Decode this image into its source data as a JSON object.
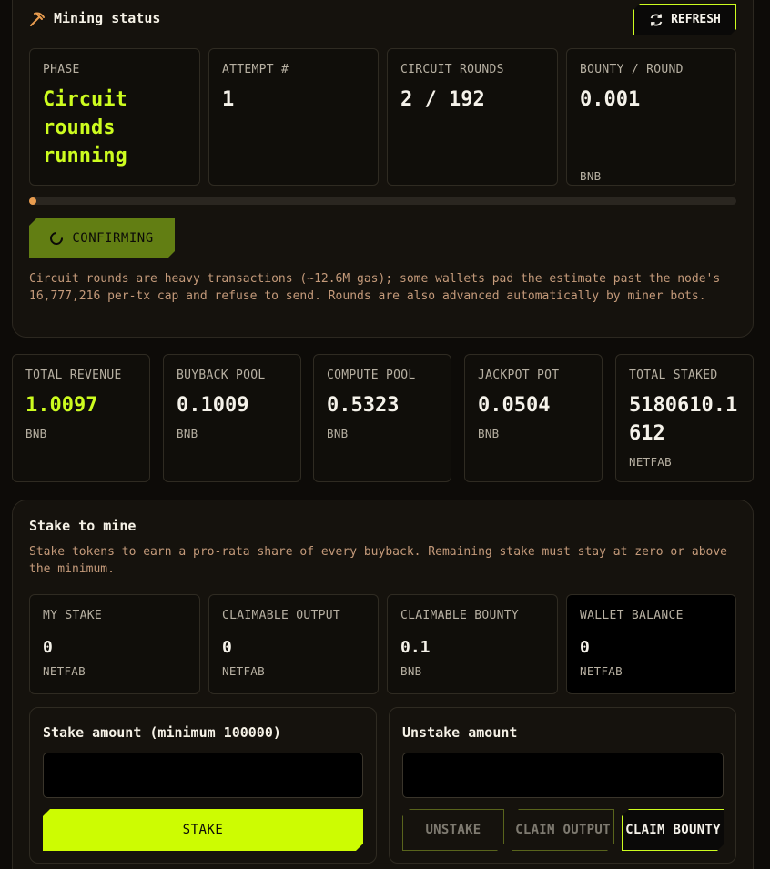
{
  "mining": {
    "title": "Mining status",
    "refresh_label": "REFRESH",
    "cards": [
      {
        "label": "PHASE",
        "value": "Circuit rounds running",
        "unit": ""
      },
      {
        "label": "ATTEMPT #",
        "value": "1",
        "unit": ""
      },
      {
        "label": "CIRCUIT ROUNDS",
        "value": "2 / 192",
        "unit": ""
      },
      {
        "label": "BOUNTY / ROUND",
        "value": "0.001",
        "unit": "BNB"
      }
    ],
    "progress_fraction": 0.0104,
    "confirm_label": "CONFIRMING",
    "note": "Circuit rounds are heavy transactions (~12.6M gas); some wallets pad the estimate past the node's 16,777,216 per-tx cap and refuse to send. Rounds are also advanced automatically by miner bots."
  },
  "stats": [
    {
      "label": "TOTAL REVENUE",
      "value": "1.0097",
      "unit": "BNB"
    },
    {
      "label": "BUYBACK POOL",
      "value": "0.1009",
      "unit": "BNB"
    },
    {
      "label": "COMPUTE POOL",
      "value": "0.5323",
      "unit": "BNB"
    },
    {
      "label": "JACKPOT POT",
      "value": "0.0504",
      "unit": "BNB"
    },
    {
      "label": "TOTAL STAKED",
      "value": "5180610.1612",
      "unit": "NETFAB"
    }
  ],
  "stake": {
    "title": "Stake to mine",
    "note": "Stake tokens to earn a pro-rata share of every buyback. Remaining stake must stay at zero or above the minimum.",
    "cards": [
      {
        "label": "MY STAKE",
        "value": "0",
        "unit": "NETFAB"
      },
      {
        "label": "CLAIMABLE OUTPUT",
        "value": "0",
        "unit": "NETFAB"
      },
      {
        "label": "CLAIMABLE BOUNTY",
        "value": "0.1",
        "unit": "BNB"
      },
      {
        "label": "WALLET BALANCE",
        "value": "0",
        "unit": "NETFAB"
      }
    ],
    "stake_panel": {
      "title": "Stake amount (minimum 100000)",
      "input_value": "",
      "button_label": "STAKE"
    },
    "unstake_panel": {
      "title": "Unstake amount",
      "input_value": "",
      "unstake_label": "UNSTAKE",
      "claim_output_label": "CLAIM OUTPUT",
      "claim_bounty_label": "CLAIM BOUNTY"
    }
  },
  "colors": {
    "accent": "#cdfc1f",
    "progress": "#e89c4f",
    "confirm": "#627e13"
  },
  "icons": {
    "mining": "pickaxe-icon",
    "refresh": "refresh-icon",
    "spinner": "spinner-icon"
  }
}
